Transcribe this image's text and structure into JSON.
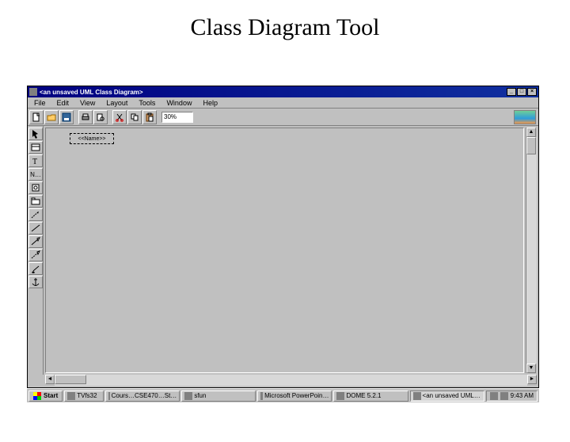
{
  "slide": {
    "title": "Class Diagram Tool"
  },
  "window": {
    "title": "<an unsaved UML Class Diagram>",
    "controls": {
      "min": "_",
      "max": "□",
      "close": "×"
    }
  },
  "menu": {
    "file": "File",
    "edit": "Edit",
    "view": "View",
    "layout": "Layout",
    "tools": "Tools",
    "window": "Window",
    "help": "Help"
  },
  "toolbar": {
    "icons": {
      "new": "new-file-icon",
      "open": "open-folder-icon",
      "save": "save-disk-icon",
      "print": "print-icon",
      "printpreview": "print-preview-icon",
      "cut": "cut-icon",
      "copy": "copy-icon",
      "paste": "paste-icon"
    },
    "zoom": "30%"
  },
  "toolbox": {
    "icons": [
      "pointer-icon",
      "class-icon",
      "text-icon",
      "note-icon",
      "interface-icon",
      "package-icon",
      "dependency-icon",
      "association-icon",
      "generalization-icon",
      "realization-icon",
      "aggregation-icon",
      "anchor-icon"
    ],
    "note_label": "N…"
  },
  "canvas": {
    "placeholder_object": "<<Name>>"
  },
  "scroll": {
    "up": "▲",
    "down": "▼",
    "left": "◄",
    "right": "►"
  },
  "taskbar": {
    "start": "Start",
    "quicklaunch": "TVfs32",
    "items": [
      {
        "label": "Cours…CSE470…St…"
      },
      {
        "label": "sfun"
      },
      {
        "label": "Microsoft PowerPoin…"
      },
      {
        "label": "DOME 5.2.1"
      },
      {
        "label": "<an unsaved UML…",
        "active": true
      }
    ],
    "clock": "9:43 AM"
  }
}
